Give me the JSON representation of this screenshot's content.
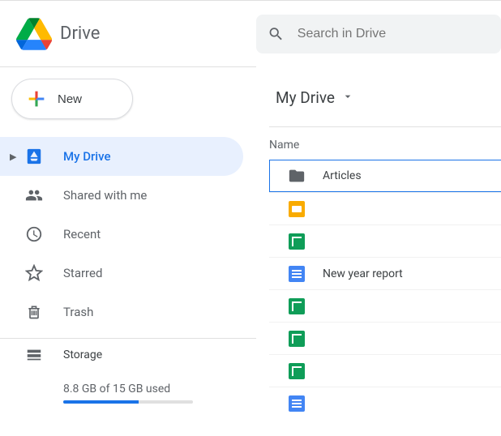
{
  "product_name": "Drive",
  "search": {
    "placeholder": "Search in Drive"
  },
  "new_button_label": "New",
  "sidebar": {
    "items": [
      {
        "label": "My Drive"
      },
      {
        "label": "Shared with me"
      },
      {
        "label": "Recent"
      },
      {
        "label": "Starred"
      },
      {
        "label": "Trash"
      }
    ],
    "storage_label": "Storage",
    "storage_usage": "8.8 GB of 15 GB used"
  },
  "breadcrumb": {
    "label": "My Drive"
  },
  "column_header": "Name",
  "files": [
    {
      "name": "Articles",
      "type": "folder"
    },
    {
      "name": "",
      "type": "slides"
    },
    {
      "name": "",
      "type": "sheet"
    },
    {
      "name": "New year report",
      "type": "doc"
    },
    {
      "name": "",
      "type": "sheet"
    },
    {
      "name": "",
      "type": "sheet"
    },
    {
      "name": "",
      "type": "sheet"
    },
    {
      "name": "",
      "type": "doc"
    }
  ]
}
